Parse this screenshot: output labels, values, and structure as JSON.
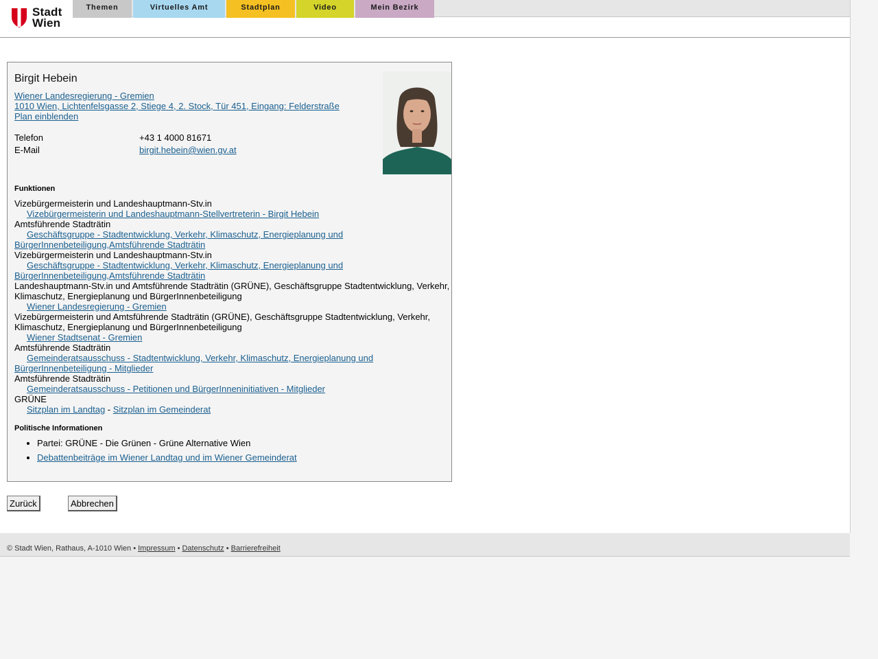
{
  "header": {
    "logo_text_line1": "Stadt",
    "logo_text_line2": "Wien",
    "nav": [
      {
        "label": "Themen",
        "color": "#c8c8c8"
      },
      {
        "label": "Virtuelles Amt",
        "color": "#a8d8f0"
      },
      {
        "label": "Stadtplan",
        "color": "#f5c022"
      },
      {
        "label": "Video",
        "color": "#d4d42a"
      },
      {
        "label": "Mein Bezirk",
        "color": "#c9a9c4"
      }
    ]
  },
  "person": {
    "name": "Birgit Hebein",
    "org_link": "Wiener Landesregierung - Gremien ",
    "address_link": "1010 Wien, Lichtenfelsgasse 2, Stiege 4, 2. Stock, Tür 451, Eingang: Felderstraße",
    "plan_link": "Plan einblenden",
    "contact": {
      "phone_label": "Telefon",
      "phone_value": "+43 1 4000 81671",
      "email_label": "E-Mail",
      "email_value": "birgit.hebein@wien.gv.at"
    }
  },
  "functions": {
    "title": "Funktionen",
    "items": [
      {
        "role": "Vizebürgermeisterin und Landeshauptmann-Stv.in",
        "link": "Vizebürgermeisterin und Landeshauptmann-Stellvertreterin - Birgit Hebein"
      },
      {
        "role": "Amtsführende Stadträtin",
        "link": "Geschäftsgruppe - Stadtentwicklung, Verkehr, Klimaschutz, Energieplanung und BürgerInnenbeteiligung,Amtsführende Stadträtin"
      },
      {
        "role": "Vizebürgermeisterin und Landeshauptmann-Stv.in",
        "link": "Geschäftsgruppe - Stadtentwicklung, Verkehr, Klimaschutz, Energieplanung und BürgerInnenbeteiligung,Amtsführende Stadträtin"
      },
      {
        "role": "Landeshauptmann-Stv.in und Amtsführende Stadträtin (GRÜNE), Geschäftsgruppe Stadtentwicklung, Verkehr, Klimaschutz, Energieplanung und BürgerInnenbeteiligung",
        "link": "Wiener Landesregierung - Gremien"
      },
      {
        "role": "Vizebürgermeisterin und Amtsführende Stadträtin (GRÜNE), Geschäftsgruppe Stadtentwicklung, Verkehr, Klimaschutz, Energieplanung und BürgerInnenbeteiligung",
        "link": "Wiener Stadtsenat - Gremien"
      },
      {
        "role": "Amtsführende Stadträtin",
        "link": "Gemeinderatsausschuss - Stadtentwicklung, Verkehr, Klimaschutz, Energieplanung und BürgerInnenbeteiligung - Mitglieder"
      },
      {
        "role": "Amtsführende Stadträtin",
        "link": "Gemeinderatsausschuss - Petitionen und BürgerInneninitiativen - Mitglieder"
      }
    ],
    "party_role": "GRÜNE",
    "seat_link_1": "Sitzplan im Landtag",
    "seat_sep": " - ",
    "seat_link_2": "Sitzplan im Gemeinderat"
  },
  "political": {
    "title": "Politische Informationen",
    "party": "Partei: GRÜNE - Die Grünen - Grüne Alternative Wien",
    "debates_link": "Debattenbeiträge im Wiener Landtag und im Wiener Gemeinderat"
  },
  "buttons": {
    "back": "Zurück",
    "cancel": "Abbrechen"
  },
  "footer": {
    "copyright": "© Stadt Wien, Rathaus, A-1010 Wien • ",
    "impressum": "Impressum",
    "sep": " • ",
    "datenschutz": "Datenschutz",
    "barrierefreiheit": "Barrierefreiheit"
  }
}
